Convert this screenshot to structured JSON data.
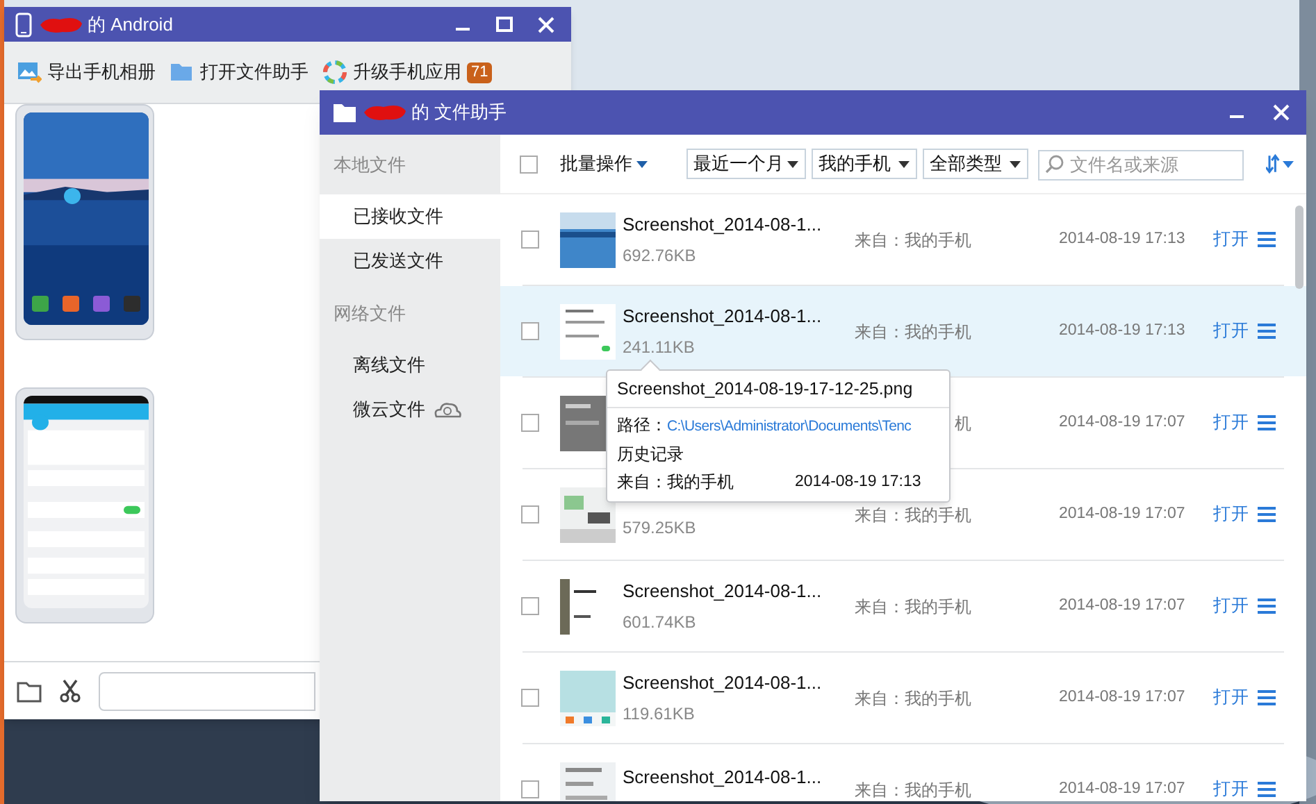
{
  "android_window": {
    "title": "的 Android",
    "toolbar": [
      {
        "label": "导出手机相册"
      },
      {
        "label": "打开文件助手"
      },
      {
        "label": "升级手机应用",
        "badge": "71"
      }
    ]
  },
  "file_helper": {
    "title": "的 文件助手",
    "sidebar": [
      {
        "kind": "header",
        "label": "本地文件"
      },
      {
        "kind": "item",
        "label": "已接收文件",
        "selected": true
      },
      {
        "kind": "item",
        "label": "已发送文件",
        "selected": false
      },
      {
        "kind": "header",
        "label": "网络文件"
      },
      {
        "kind": "item",
        "label": "离线文件",
        "selected": false
      },
      {
        "kind": "item",
        "label": "微云文件",
        "selected": false
      }
    ],
    "toolbar": {
      "select_all": {
        "checked": false
      },
      "batch": "批量操作",
      "filters": [
        "最近一个月",
        "我的手机",
        "全部类型"
      ],
      "search": {
        "placeholder": "文件名或来源"
      }
    },
    "files": [
      {
        "name": "Screenshot_2014-08-1...",
        "size": "692.76KB",
        "source": "来自：我的手机",
        "time": "2014-08-19 17:13",
        "action": "打开",
        "checked": false,
        "selected": false
      },
      {
        "name": "Screenshot_2014-08-1...",
        "size": "241.11KB",
        "source": "来自：我的手机",
        "time": "2014-08-19 17:13",
        "action": "打开",
        "checked": false,
        "selected": true
      },
      {
        "source": "机",
        "time": "2014-08-19 17:07",
        "action": "打开",
        "checked": false,
        "selected": false
      },
      {
        "size": "579.25KB",
        "source": "来自：我的手机",
        "time": "2014-08-19 17:07",
        "action": "打开",
        "checked": false,
        "selected": false
      },
      {
        "name": "Screenshot_2014-08-1...",
        "size": "601.74KB",
        "source": "来自：我的手机",
        "time": "2014-08-19 17:07",
        "action": "打开",
        "checked": false,
        "selected": false
      },
      {
        "name": "Screenshot_2014-08-1...",
        "size": "119.61KB",
        "source": "来自：我的手机",
        "time": "2014-08-19 17:07",
        "action": "打开",
        "checked": false,
        "selected": false
      },
      {
        "name": "Screenshot_2014-08-1...",
        "source": "来自：我的手机",
        "time": "2014-08-19 17:07",
        "action": "打开",
        "checked": false,
        "selected": false
      }
    ],
    "tooltip": {
      "title": "Screenshot_2014-08-19-17-12-25.png",
      "path_label": "路径：",
      "path": "C:\\Users\\Administrator\\Documents\\Tenc",
      "history": "历史记录",
      "source": "来自：我的手机",
      "time": "2014-08-19 17:13"
    }
  }
}
